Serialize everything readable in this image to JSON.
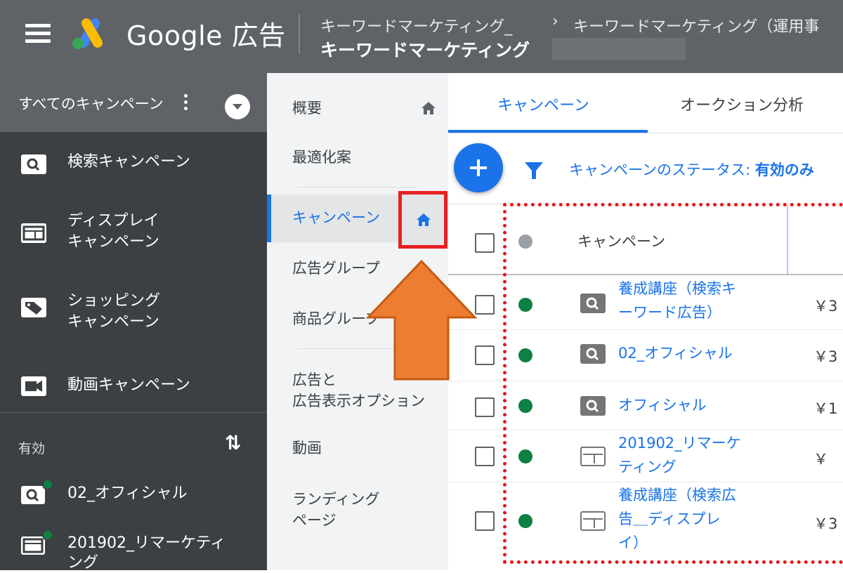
{
  "header": {
    "brand": "Google 広告",
    "breadcrumb_parent": "キーワードマーケティング_",
    "breadcrumb_sep": "›",
    "breadcrumb_current": "キーワードマーケティング（運用事",
    "account_name": "キーワードマーケティング"
  },
  "leftnav": {
    "all_campaigns": "すべてのキャンペーン",
    "types": [
      {
        "label": "検索キャンペーン",
        "icon": "search-icon"
      },
      {
        "label": "ディスプレイ\nキャンペーン",
        "icon": "display-icon"
      },
      {
        "label": "ショッピング\nキャンペーン",
        "icon": "tag-icon"
      },
      {
        "label": "動画キャンペーン",
        "icon": "video-icon"
      }
    ],
    "active_section": "有効",
    "active_items": [
      {
        "label": "02_オフィシャル",
        "icon": "search-icon"
      },
      {
        "label": "201902_リマーケティ\nング",
        "icon": "display-icon"
      }
    ]
  },
  "secnav": {
    "items": [
      {
        "label": "概要"
      },
      {
        "label": "最適化案"
      },
      {
        "label": "キャンペーン"
      },
      {
        "label": "広告グループ"
      },
      {
        "label": "商品グループ"
      },
      {
        "label": "広告と\n広告表示オプション"
      },
      {
        "label": "動画"
      },
      {
        "label": "ランディング\nページ"
      }
    ]
  },
  "main": {
    "tabs": [
      {
        "label": "キャンペーン",
        "active": true
      },
      {
        "label": "オークション分析",
        "active": false
      }
    ],
    "filter_label": "キャンペーンのステータス: ",
    "filter_value": "有効のみ",
    "table": {
      "header_campaign": "キャンペーン",
      "rows": [
        {
          "name": "養成講座（検索キ\nーワード広告）",
          "type": "search",
          "budget": "￥3"
        },
        {
          "name": "02_オフィシャル",
          "type": "search",
          "budget": "￥3"
        },
        {
          "name": "オフィシャル",
          "type": "search",
          "budget": "￥1"
        },
        {
          "name": "201902_リマーケ\nティング",
          "type": "display",
          "budget": "￥"
        },
        {
          "name": "養成講座（検索広\n告＿ディスプレ\nイ）",
          "type": "display",
          "budget": "￥3"
        }
      ]
    }
  },
  "colors": {
    "topbar": "#5f6368",
    "leftnav": "#3c4043",
    "accent_blue": "#1a73e8",
    "status_green": "#0d8043",
    "highlight_red": "#e52222",
    "arrow_orange": "#ed7d31"
  }
}
